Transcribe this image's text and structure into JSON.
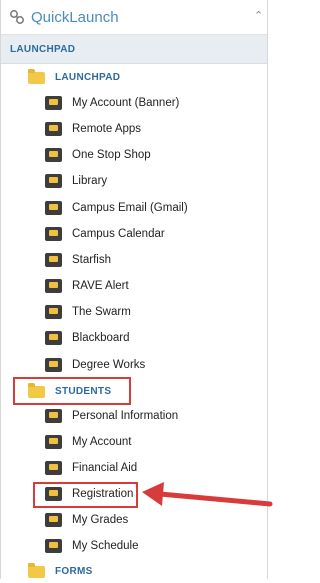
{
  "header": {
    "title": "QuickLaunch",
    "icon": "link-icon"
  },
  "section": {
    "label": "LAUNCHPAD"
  },
  "launchpad_folder": {
    "label": "LAUNCHPAD"
  },
  "launchpad_items": [
    {
      "label": "My Account (Banner)",
      "icon": "account-card-icon"
    },
    {
      "label": "Remote Apps",
      "icon": "remote-apps-icon"
    },
    {
      "label": "One Stop Shop",
      "icon": "one-stop-shop-icon"
    },
    {
      "label": "Library",
      "icon": "library-icon"
    },
    {
      "label": "Campus Email (Gmail)",
      "icon": "email-icon"
    },
    {
      "label": "Campus Calendar",
      "icon": "calendar-icon"
    },
    {
      "label": "Starfish",
      "icon": "starfish-icon"
    },
    {
      "label": "RAVE Alert",
      "icon": "alert-icon"
    },
    {
      "label": "The Swarm",
      "icon": "swarm-icon"
    },
    {
      "label": "Blackboard",
      "icon": "blackboard-icon"
    },
    {
      "label": "Degree Works",
      "icon": "degree-works-icon"
    }
  ],
  "students_folder": {
    "label": "STUDENTS"
  },
  "students_items": [
    {
      "label": "Personal Information",
      "icon": "person-icon"
    },
    {
      "label": "My Account",
      "icon": "account-icon"
    },
    {
      "label": "Financial Aid",
      "icon": "financial-aid-icon"
    },
    {
      "label": "Registration",
      "icon": "registration-icon"
    },
    {
      "label": "My Grades",
      "icon": "grades-icon"
    },
    {
      "label": "My Schedule",
      "icon": "schedule-icon"
    }
  ],
  "forms_folder": {
    "label": "FORMS"
  },
  "colors": {
    "accent": "#2c6aa0",
    "highlight": "#d83b3b",
    "folder": "#f3c846"
  }
}
